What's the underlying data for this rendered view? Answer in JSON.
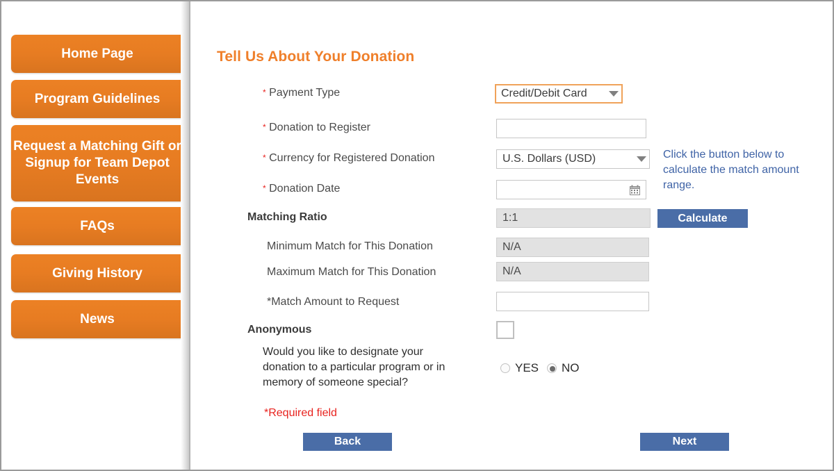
{
  "theme": {
    "orange": "#ec8124",
    "heading_orange": "#ef7f2a",
    "blue": "#4a6da7",
    "hint_blue": "#3f63a6",
    "required_red": "#e8231f",
    "readonly_grey": "#e2e2e2"
  },
  "sidebar": {
    "items": [
      {
        "label": "Home Page",
        "name": "home-page"
      },
      {
        "label": "Program Guidelines",
        "name": "program-guidelines"
      },
      {
        "label": "Request a Matching Gift or Signup for Team Depot Events",
        "name": "request-matching-gift"
      },
      {
        "label": "FAQs",
        "name": "faqs"
      },
      {
        "label": "Giving History",
        "name": "giving-history"
      },
      {
        "label": "News",
        "name": "news"
      }
    ]
  },
  "main": {
    "title": "Tell Us About Your Donation",
    "fields": {
      "payment_type": {
        "label": "Payment Type",
        "required_marker": "*",
        "value": "Credit/Debit Card",
        "icon": "chevron-down-icon"
      },
      "donation_to_register": {
        "label": "Donation to Register",
        "required_marker": "*",
        "value": "",
        "placeholder": ""
      },
      "currency": {
        "label": "Currency for Registered Donation",
        "required_marker": "*",
        "value": "U.S. Dollars (USD)",
        "icon": "chevron-down-icon"
      },
      "donation_date": {
        "label": "Donation Date",
        "required_marker": "*",
        "value": "",
        "placeholder": "",
        "icon": "calendar-icon"
      },
      "matching_ratio": {
        "label": "Matching Ratio",
        "value": "1:1"
      },
      "minimum_match": {
        "label": "Minimum Match for This Donation",
        "value": "N/A"
      },
      "maximum_match": {
        "label": "Maximum Match for This Donation",
        "value": "N/A"
      },
      "match_amount": {
        "label": "*Match Amount to Request",
        "value": "",
        "placeholder": ""
      },
      "anonymous": {
        "label": "Anonymous",
        "checked": false
      },
      "designate": {
        "question": "Would you like to designate your donation to a particular program or in memory of someone special?",
        "options": [
          {
            "label": "YES",
            "selected": false
          },
          {
            "label": "NO",
            "selected": true
          }
        ]
      }
    },
    "hint": "Click the button below to calculate the match amount range.",
    "calculate_label": "Calculate",
    "required_note": "*Required field",
    "back_label": "Back",
    "next_label": "Next"
  }
}
